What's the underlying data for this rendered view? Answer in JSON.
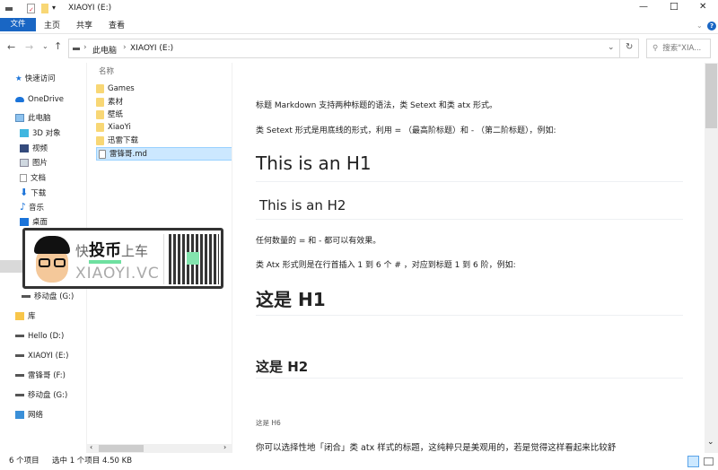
{
  "window": {
    "title": "XIAOYI (E:)",
    "minimize": "—",
    "maximize": "☐",
    "close": "✕"
  },
  "ribbon": {
    "tabs": [
      "文件",
      "主页",
      "共享",
      "查看"
    ],
    "help": "?"
  },
  "address": {
    "crumbs": [
      "此电脑",
      "XIAOYI (E:)"
    ],
    "search_placeholder": "搜索\"XIA..."
  },
  "nav": {
    "items": [
      {
        "label": "快速访问",
        "icon": "star-icon"
      },
      {
        "label": "OneDrive",
        "icon": "cloud-icon"
      },
      {
        "label": "此电脑",
        "icon": "computer-icon"
      },
      {
        "label": "3D 对象",
        "icon": "cube-icon"
      },
      {
        "label": "视频",
        "icon": "video-icon"
      },
      {
        "label": "图片",
        "icon": "picture-icon"
      },
      {
        "label": "文档",
        "icon": "document-icon"
      },
      {
        "label": "下载",
        "icon": "download-icon"
      },
      {
        "label": "音乐",
        "icon": "music-icon"
      },
      {
        "label": "桌面",
        "icon": "desktop-icon"
      },
      {
        "label": "移动盘 (G:)",
        "icon": "drive-icon"
      },
      {
        "label": "库",
        "icon": "library-icon"
      },
      {
        "label": "Hello (D:)",
        "icon": "drive-icon"
      },
      {
        "label": "XIAOYI (E:)",
        "icon": "drive-icon"
      },
      {
        "label": "雷锋哥 (F:)",
        "icon": "drive-icon"
      },
      {
        "label": "移动盘 (G:)",
        "icon": "drive-icon"
      },
      {
        "label": "网络",
        "icon": "network-icon"
      }
    ]
  },
  "files": {
    "header": "名称",
    "items": [
      "Games",
      "素材",
      "壁纸",
      "XiaoYi",
      "迅雷下载",
      "雷锋哥.md"
    ],
    "selected": "雷锋哥.md"
  },
  "preview": {
    "p1": "标题 Markdown 支持两种标题的语法，类 Setext 和类 atx 形式。",
    "p2": "类 Setext 形式是用底线的形式，利用 = （最高阶标题）和 - （第二阶标题），例如:",
    "h1a": "This is an H1",
    "h2a": "This is an H2",
    "p3": "任何数量的 = 和 - 都可以有效果。",
    "p4": "类 Atx 形式则是在行首插入 1 到 6 个 # ，对应到标题 1 到 6 阶，例如:",
    "h1b": "这是 H1",
    "h2b": "这是 H2",
    "h6": "这是 H6",
    "p5": "你可以选择性地「闭合」类 atx 样式的标题，这纯粹只是美观用的，若是觉得这样看起来比较舒"
  },
  "banner": {
    "line1a": "快",
    "line1b": "投币",
    "line1c": "上车",
    "line2": "XIAOYI.VC"
  },
  "status": {
    "count": "6 个项目",
    "selected": "选中 1 个项目",
    "size": "4.50 KB"
  }
}
